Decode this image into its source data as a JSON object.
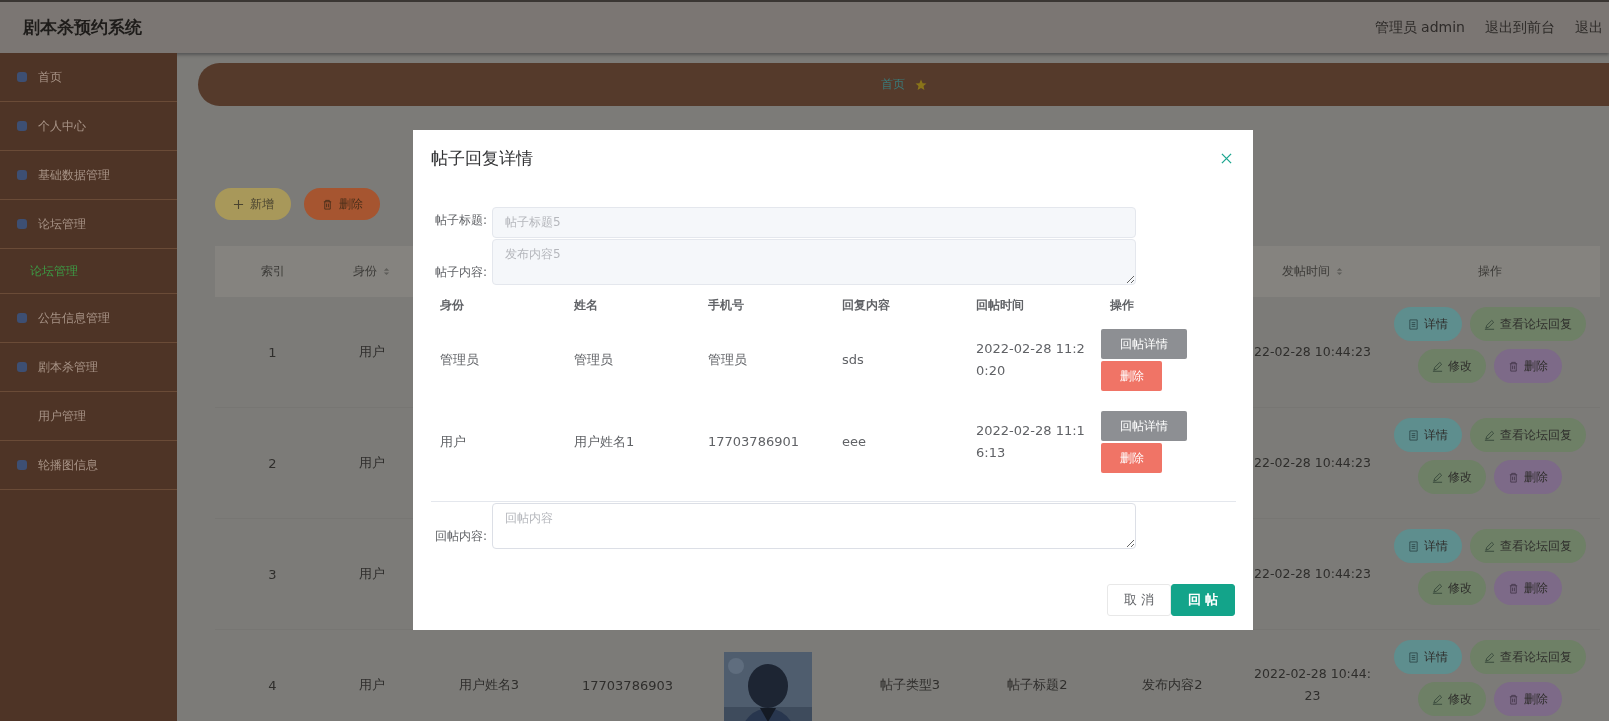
{
  "header": {
    "title": "剧本杀预约系统",
    "user": "管理员 admin",
    "links": [
      "退出到前台",
      "退出"
    ]
  },
  "sidebar": {
    "items": [
      {
        "label": "首页",
        "kind": "icon"
      },
      {
        "label": "个人中心",
        "kind": "icon"
      },
      {
        "label": "基础数据管理",
        "kind": "icon"
      },
      {
        "label": "论坛管理",
        "kind": "icon",
        "children": [
          {
            "label": "论坛管理",
            "selected": true
          }
        ]
      },
      {
        "label": "公告信息管理",
        "kind": "icon"
      },
      {
        "label": "剧本杀管理",
        "kind": "icon"
      },
      {
        "label": "用户管理",
        "kind": "plain"
      },
      {
        "label": "轮播图信息",
        "kind": "icon"
      }
    ]
  },
  "breadcrumb": {
    "items": [
      "首页"
    ]
  },
  "toolbar": {
    "buttons": [
      {
        "label": "新增",
        "kind": "add"
      },
      {
        "label": "删除",
        "kind": "delete"
      }
    ]
  },
  "table": {
    "columns": {
      "index": {
        "label": "索引",
        "sortable": false
      },
      "identity": {
        "label": "身份",
        "sortable": true
      },
      "time": {
        "label": "发帖时间",
        "sortable": true
      },
      "actions": {
        "label": "操作",
        "sortable": false
      }
    },
    "rows": [
      {
        "index": "1",
        "identity": "用户",
        "time": "22-02-28 10:44:23",
        "actions": [
          {
            "label": "详情",
            "kind": "detail"
          },
          {
            "label": "查看论坛回复",
            "kind": "reply"
          },
          {
            "label": "修改",
            "kind": "edit"
          },
          {
            "label": "删除",
            "kind": "delete"
          }
        ]
      },
      {
        "index": "2",
        "identity": "用户",
        "time": "22-02-28 10:44:23",
        "actions": [
          {
            "label": "详情",
            "kind": "detail"
          },
          {
            "label": "查看论坛回复",
            "kind": "reply"
          },
          {
            "label": "修改",
            "kind": "edit"
          },
          {
            "label": "删除",
            "kind": "delete"
          }
        ]
      },
      {
        "index": "3",
        "identity": "用户",
        "time": "22-02-28 10:44:23",
        "actions": [
          {
            "label": "详情",
            "kind": "detail"
          },
          {
            "label": "查看论坛回复",
            "kind": "reply"
          },
          {
            "label": "修改",
            "kind": "edit"
          },
          {
            "label": "删除",
            "kind": "delete"
          }
        ]
      },
      {
        "index": "4",
        "identity": "用户",
        "name": "用户姓名3",
        "phone": "17703786903",
        "picture": {
          "kind": "picture"
        },
        "type": "帖子类型3",
        "title": "帖子标题2",
        "content": "发布内容2",
        "time": "2022-02-28 10:44:23",
        "actions": [
          {
            "label": "详情",
            "kind": "detail"
          },
          {
            "label": "查看论坛回复",
            "kind": "reply"
          },
          {
            "label": "修改",
            "kind": "edit"
          },
          {
            "label": "删除",
            "kind": "delete"
          }
        ]
      }
    ]
  },
  "dialog": {
    "title": "帖子回复详情",
    "fields": [
      {
        "label": "帖子标题:",
        "value": "帖子标题5",
        "kind": "input",
        "disabled": true
      },
      {
        "label": "帖子内容:",
        "value": "发布内容5",
        "kind": "textarea",
        "disabled": true
      }
    ],
    "replies": {
      "columns": [
        "身份",
        "姓名",
        "手机号",
        "回复内容",
        "回帖时间",
        "操作"
      ],
      "rows": [
        {
          "cells": [
            "管理员",
            "管理员",
            "管理员",
            "sds",
            "2022-02-28 11:20:20"
          ],
          "actions": [
            {
              "label": "回帖详情",
              "kind": "detail"
            },
            {
              "label": "删除",
              "kind": "delete"
            }
          ]
        },
        {
          "cells": [
            "用户",
            "用户姓名1",
            "17703786901",
            "eee",
            "2022-02-28 11:16:13"
          ],
          "actions": [
            {
              "label": "回帖详情",
              "kind": "detail"
            },
            {
              "label": "删除",
              "kind": "delete"
            }
          ]
        }
      ]
    },
    "reply_field": {
      "label": "回帖内容:",
      "placeholder": "回帖内容"
    },
    "buttons": [
      {
        "label": "取 消",
        "kind": "cancel"
      },
      {
        "label": "回 帖",
        "kind": "primary"
      }
    ]
  }
}
